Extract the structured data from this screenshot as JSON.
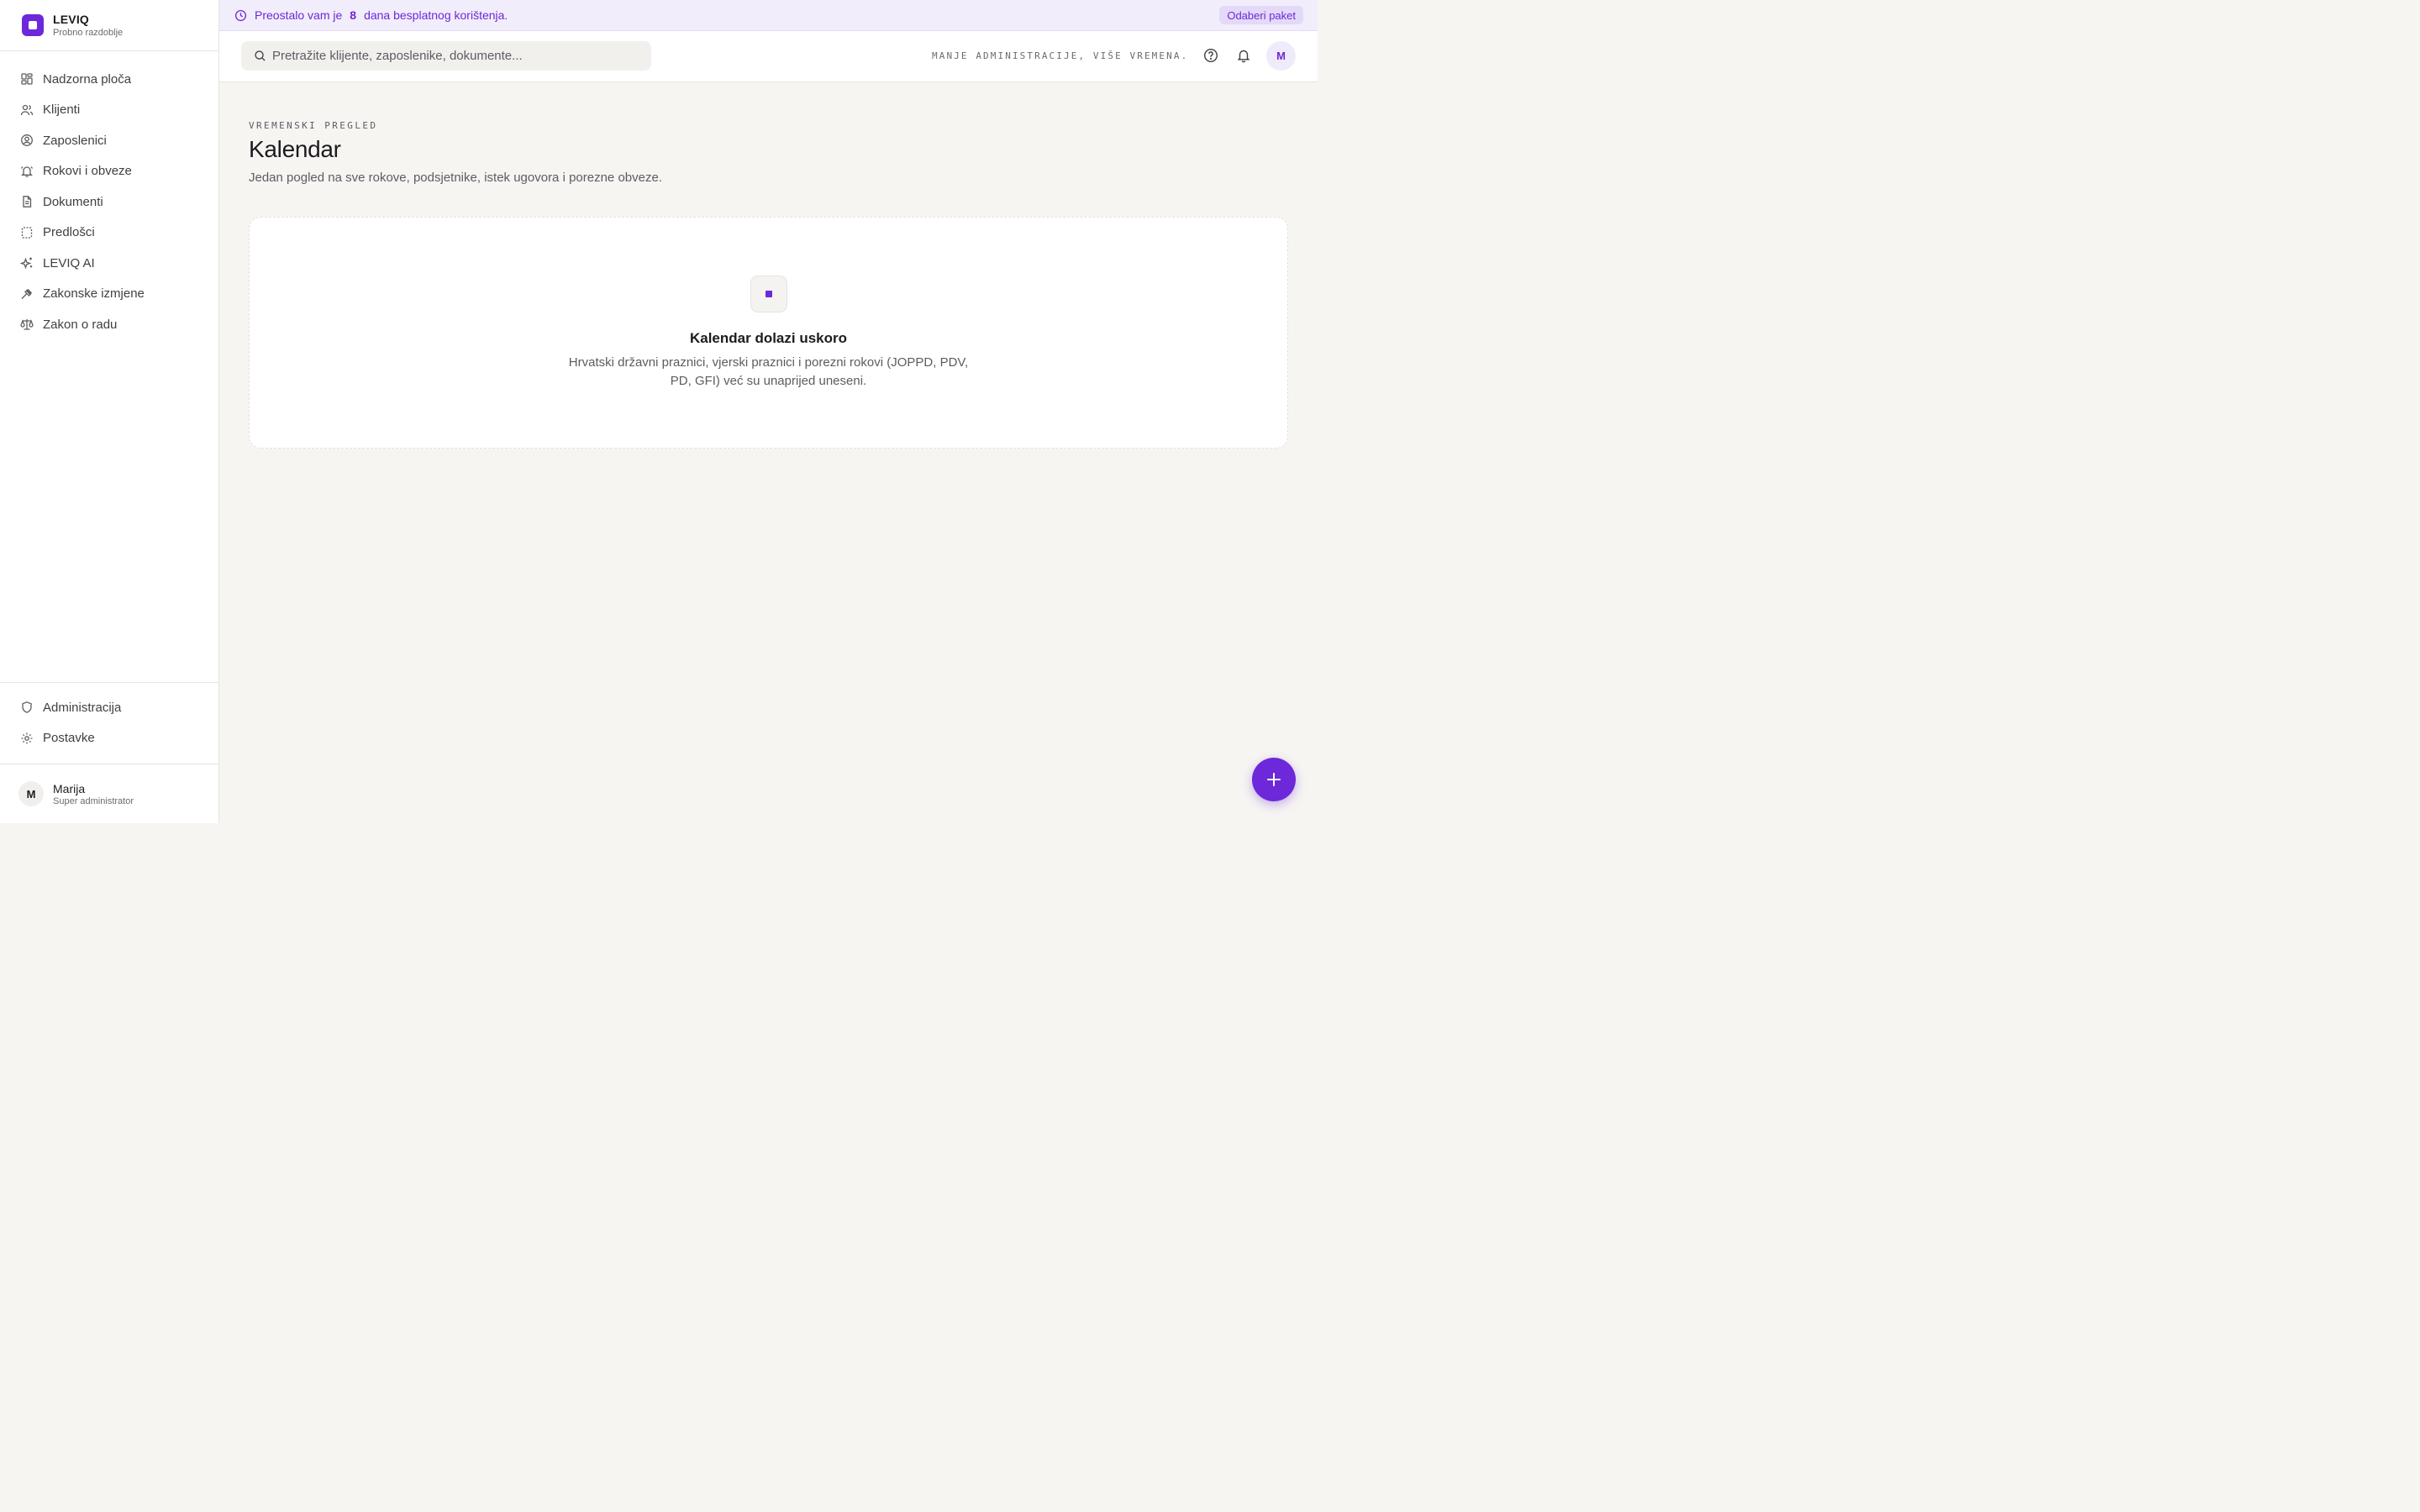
{
  "brand": {
    "name": "LEVIQ",
    "subtitle": "Probno razdoblje"
  },
  "sidebar": {
    "items": [
      {
        "label": "Nadzorna ploča",
        "icon": "dashboard-icon"
      },
      {
        "label": "Klijenti",
        "icon": "users-icon"
      },
      {
        "label": "Zaposlenici",
        "icon": "user-circle-icon"
      },
      {
        "label": "Rokovi i obveze",
        "icon": "bell-alarm-icon"
      },
      {
        "label": "Dokumenti",
        "icon": "document-icon"
      },
      {
        "label": "Predlošci",
        "icon": "template-icon"
      },
      {
        "label": "LEVIQ AI",
        "icon": "sparkles-icon"
      },
      {
        "label": "Zakonske izmjene",
        "icon": "gavel-icon"
      },
      {
        "label": "Zakon o radu",
        "icon": "scale-icon"
      }
    ],
    "bottom_items": [
      {
        "label": "Administracija",
        "icon": "shield-icon"
      },
      {
        "label": "Postavke",
        "icon": "gear-icon"
      }
    ],
    "user": {
      "initial": "M",
      "name": "Marija",
      "role": "Super administrator"
    }
  },
  "banner": {
    "prefix": "Preostalo vam je",
    "days": "8",
    "suffix": "dana besplatnog korištenja.",
    "button": "Odaberi paket"
  },
  "topbar": {
    "search_placeholder": "Pretražite klijente, zaposlenike, dokumente...",
    "tagline": "MANJE ADMINISTRACIJE, VIŠE VREMENA.",
    "avatar_initial": "M"
  },
  "main": {
    "eyebrow": "VREMENSKI PREGLED",
    "title": "Kalendar",
    "subtitle": "Jedan pogled na sve rokove, podsjetnike, istek ugovora i porezne obveze.",
    "empty_state": {
      "title": "Kalendar dolazi uskoro",
      "text": "Hrvatski državni praznici, vjerski praznici i porezni rokovi (JOPPD, PDV, PD, GFI) već su unaprijed uneseni."
    }
  },
  "colors": {
    "accent": "#6d28d9",
    "banner_bg": "#f2edfb",
    "page_bg": "#f6f5f2"
  }
}
